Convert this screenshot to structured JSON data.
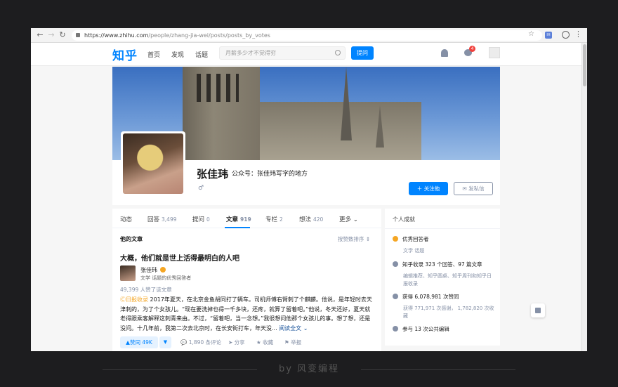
{
  "browser": {
    "url_host": "https://www.zhihu.com",
    "url_path": "/people/zhang-jia-wei/posts/posts_by_votes"
  },
  "topbar": {
    "logo": "知乎",
    "nav": [
      "首页",
      "发现",
      "话题"
    ],
    "search_placeholder": "月薪多少才不觉得穷",
    "ask_label": "提问",
    "msg_badge": "4"
  },
  "profile": {
    "name": "张佳玮",
    "headline": "公众号：张佳玮写字的地方",
    "gender_icon": "♂",
    "follow_label": "关注他",
    "message_label": "发私信"
  },
  "tabs": [
    {
      "label": "动态",
      "count": ""
    },
    {
      "label": "回答",
      "count": "3,499"
    },
    {
      "label": "提问",
      "count": "0"
    },
    {
      "label": "文章",
      "count": "919"
    },
    {
      "label": "专栏",
      "count": "2"
    },
    {
      "label": "想法",
      "count": "420"
    },
    {
      "label": "更多",
      "count": ""
    }
  ],
  "section": {
    "title": "他的文章",
    "sort": "按赞数排序"
  },
  "article": {
    "title": "大概，他们就是世上活得最明白的人吧",
    "author": "张佳玮",
    "author_desc": "文学 话题的优秀回答者",
    "likes_line": "49,399 人赞了该文章",
    "tag": "日报收录",
    "excerpt": "2017年夏天，在北京金鱼胡同打了辆车。司机师傅右臂刺了个麒麟。他说，是年轻时去天津刺的，为了个女孩儿。“现在要洗掉也得一千多块，还疼，就算了留着吧。”他说，冬天还好，夏天就老得跟乘客解释这刺青来由。不过，“留着吧，当一念想。”我很想问他那个女孩儿的事。想了想，还是没问。十几年前，我第二次去北京时，在长安街打车，年天没...",
    "read_more": "阅读全文",
    "vote_label": "赞同 49K",
    "comments": "1,890 条评论",
    "share": "分享",
    "fav": "收藏",
    "report": "举报"
  },
  "side": {
    "title": "个人成就",
    "items": [
      {
        "label": "优秀回答者",
        "sub": "文学 话题"
      },
      {
        "label": "知乎收录 323 个回答、97 篇文章",
        "sub": "编辑推荐、知乎圆桌、知乎周刊和知乎日报收录"
      },
      {
        "label": "获得 6,078,981 次赞同",
        "sub": "获得 771,971 次感谢， 1,782,820 次收藏"
      },
      {
        "label": "参与 13 次公共编辑",
        "sub": ""
      }
    ]
  },
  "footer": "by 风变编程"
}
